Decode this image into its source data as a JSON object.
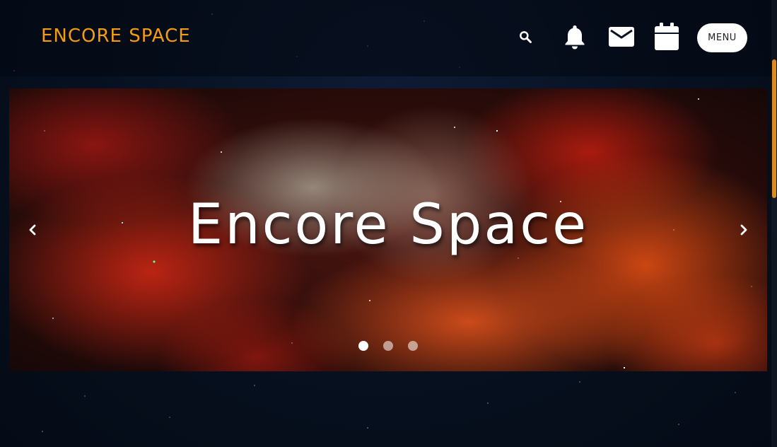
{
  "header": {
    "brand": "ENCORE SPACE",
    "icons": {
      "search": "search-icon",
      "notifications": "bell-icon",
      "messages": "mail-icon",
      "calendar": "calendar-icon"
    },
    "menu_label": "MENU"
  },
  "hero": {
    "title": "Encore Space",
    "prev_icon": "chevron-left-icon",
    "next_icon": "chevron-right-icon",
    "slides_count": 3,
    "active_slide": 1
  },
  "colors": {
    "brand": "#f39c12",
    "header_bg": "#040810",
    "page_bg": "#081224",
    "scrollbar_thumb": "#d98b22"
  }
}
